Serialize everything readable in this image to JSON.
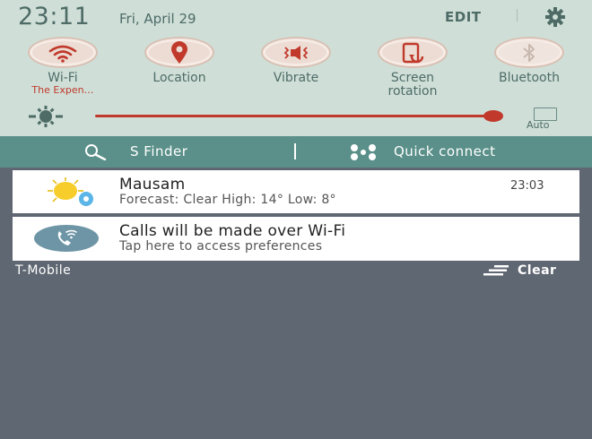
{
  "status": {
    "time": "23:11",
    "date": "Fri, April 29",
    "edit_label": "EDIT",
    "settings_icon": "gear-icon"
  },
  "toggles": [
    {
      "label": "Wi-Fi",
      "sublabel": "The Expen…",
      "icon": "wifi-icon",
      "active": true
    },
    {
      "label": "Location",
      "sublabel": "",
      "icon": "location-pin-icon",
      "active": true
    },
    {
      "label": "Vibrate",
      "sublabel": "",
      "icon": "vibrate-icon",
      "active": true
    },
    {
      "label": "Screen\nrotation",
      "sublabel": "",
      "icon": "screen-rotation-icon",
      "active": true
    },
    {
      "label": "Bluetooth",
      "sublabel": "",
      "icon": "bluetooth-icon",
      "active": false
    }
  ],
  "brightness": {
    "level": 0.98,
    "auto_label": "Auto"
  },
  "search_bar": {
    "sfinder_label": "S Finder",
    "quick_connect_label": "Quick connect"
  },
  "notifications": [
    {
      "title": "Mausam",
      "text": "Forecast: Clear High: 14° Low: 8°",
      "time": "23:03",
      "icon": "weather-sun-icon"
    },
    {
      "title": "Calls will be made over Wi-Fi",
      "text": "Tap here to access preferences",
      "icon": "wifi-calling-icon"
    }
  ],
  "footer": {
    "carrier": "T-Mobile",
    "clear_label": "Clear"
  },
  "colors": {
    "panel": "#cfdfd8",
    "accent": "#c0392b",
    "bar": "#5a9089",
    "background": "#5f6772"
  }
}
